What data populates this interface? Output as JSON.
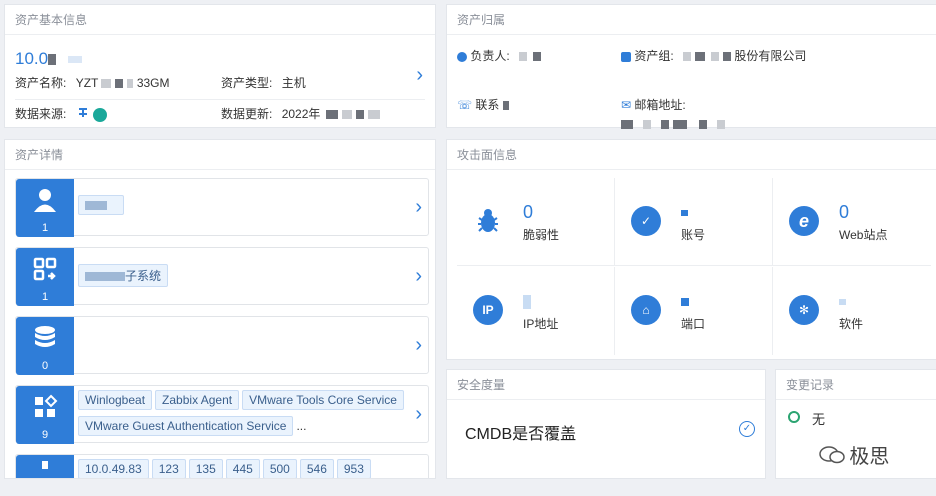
{
  "basic": {
    "title": "资产基本信息",
    "ip": "10.0",
    "name_label": "资产名称:",
    "name_value_pre": "YZT",
    "name_value_post": "33GM",
    "type_label": "资产类型:",
    "type_value": "主机",
    "source_label": "数据来源:",
    "update_label": "数据更新:",
    "update_value": "2022年"
  },
  "owner": {
    "title": "资产归属",
    "owner_label": "负责人:",
    "group_label": "资产组:",
    "group_value": "股份有限公司",
    "contact_label": "联系",
    "email_label": "邮箱地址:"
  },
  "detail": {
    "title": "资产详情",
    "cards": [
      {
        "count": "1",
        "text": ""
      },
      {
        "count": "1",
        "text": "子系统"
      },
      {
        "count": "0",
        "text": ""
      },
      {
        "count": "9",
        "tags": [
          "Winlogbeat",
          "Zabbix Agent",
          "VMware Tools Core Service",
          "VMware Guest Authentication Service"
        ],
        "more": "..."
      },
      {
        "count": "",
        "tags": [
          "10.0.49.83",
          "123",
          "135",
          "445",
          "500",
          "546",
          "953"
        ]
      }
    ]
  },
  "attack": {
    "title": "攻击面信息",
    "items": [
      {
        "value": "0",
        "label": "脆弱性",
        "icon": "bug-icon"
      },
      {
        "value": "",
        "label": "账号",
        "icon": "account-icon"
      },
      {
        "value": "0",
        "label": "Web站点",
        "icon": "web-icon"
      },
      {
        "value": "",
        "label": "IP地址",
        "icon": "ip-icon"
      },
      {
        "value": "",
        "label": "端口",
        "icon": "port-icon"
      },
      {
        "value": "",
        "label": "软件",
        "icon": "software-icon"
      }
    ],
    "ip_badge": "IP"
  },
  "security": {
    "title": "安全度量",
    "item": "CMDB是否覆盖"
  },
  "changes": {
    "title": "变更记录",
    "item": "无"
  },
  "watermark": {
    "text": "极思"
  }
}
